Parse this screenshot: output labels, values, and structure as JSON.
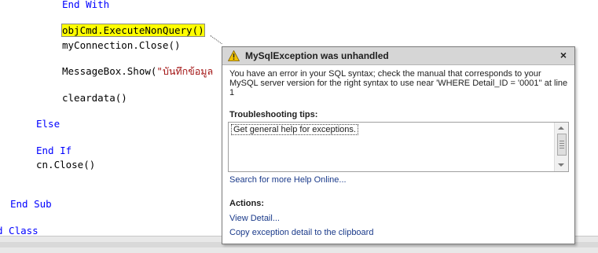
{
  "code": {
    "line1": "End With",
    "line2": "objCmd.ExecuteNonQuery()",
    "line3": "myConnection.Close()",
    "line4_method": "MessageBox.Show(",
    "line4_string": "\"บันทึกข้อมูล",
    "line5": "cleardata()",
    "line6": "Else",
    "line7": "End If",
    "line8": "cn.Close()",
    "line9": "End Sub",
    "line10": "d Class"
  },
  "dialog": {
    "title": "MySqlException was unhandled",
    "close_label": "×",
    "message": "You have an error in your SQL syntax; check the manual that corresponds to your MySQL server version for the right syntax to use near 'WHERE Detail_ID = '0001'' at line 1",
    "tips_heading": "Troubleshooting tips:",
    "tips": [
      "Get general help for exceptions."
    ],
    "search_link": "Search for more Help Online...",
    "actions_heading": "Actions:",
    "actions": [
      "View Detail...",
      "Copy exception detail to the clipboard"
    ]
  },
  "icons": {
    "warning": "warning-icon",
    "close": "close-icon"
  },
  "colors": {
    "keyword": "#0000ff",
    "string": "#a31515",
    "highlight": "#ffff00",
    "link": "#1a3a8a",
    "dialog_header": "#d6d6d6"
  }
}
